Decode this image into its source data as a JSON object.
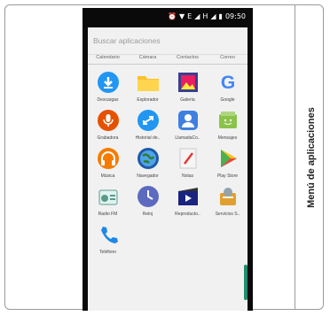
{
  "side_label": "Menú de aplicaciones",
  "status": {
    "carrier": "E",
    "network": "H",
    "battery": "▮",
    "time": "09:50"
  },
  "search_placeholder": "Buscar aplicaciones",
  "top_row": [
    "Calendario",
    "Cámara",
    "Contactos",
    "Correo"
  ],
  "apps": [
    {
      "label": "Descargas",
      "icon": "download-icon",
      "color": "#2196f3"
    },
    {
      "label": "Explorador",
      "icon": "folder-icon",
      "color": "#fbc02d"
    },
    {
      "label": "Galería",
      "icon": "gallery-icon",
      "color": "#3a3f8f"
    },
    {
      "label": "Google",
      "icon": "google-icon",
      "color": "#4285f4"
    },
    {
      "label": "Grabadora",
      "icon": "microphone-icon",
      "color": "#e65100"
    },
    {
      "label": "Historial de..",
      "icon": "call-history-icon",
      "color": "#2196f3"
    },
    {
      "label": "LlamadaCo..",
      "icon": "conference-call-icon",
      "color": "#3f7fe0"
    },
    {
      "label": "Mensajes",
      "icon": "messages-icon",
      "color": "#8bc34a"
    },
    {
      "label": "Música",
      "icon": "headphones-icon",
      "color": "#f57c00"
    },
    {
      "label": "Navegador",
      "icon": "globe-icon",
      "color": "#1e5aa8"
    },
    {
      "label": "Notas",
      "icon": "notes-icon",
      "color": "#e53935"
    },
    {
      "label": "Play Store",
      "icon": "play-store-icon",
      "color": "#00bcd4"
    },
    {
      "label": "Radio FM",
      "icon": "radio-icon",
      "color": "#5a9a8a"
    },
    {
      "label": "Reloj",
      "icon": "clock-icon",
      "color": "#5c6bc0"
    },
    {
      "label": "Reproducto..",
      "icon": "video-player-icon",
      "color": "#1a237e"
    },
    {
      "label": "Servicios S..",
      "icon": "sim-services-icon",
      "color": "#e0a030"
    },
    {
      "label": "Teléfono",
      "icon": "phone-icon",
      "color": "#1e88e5"
    }
  ]
}
